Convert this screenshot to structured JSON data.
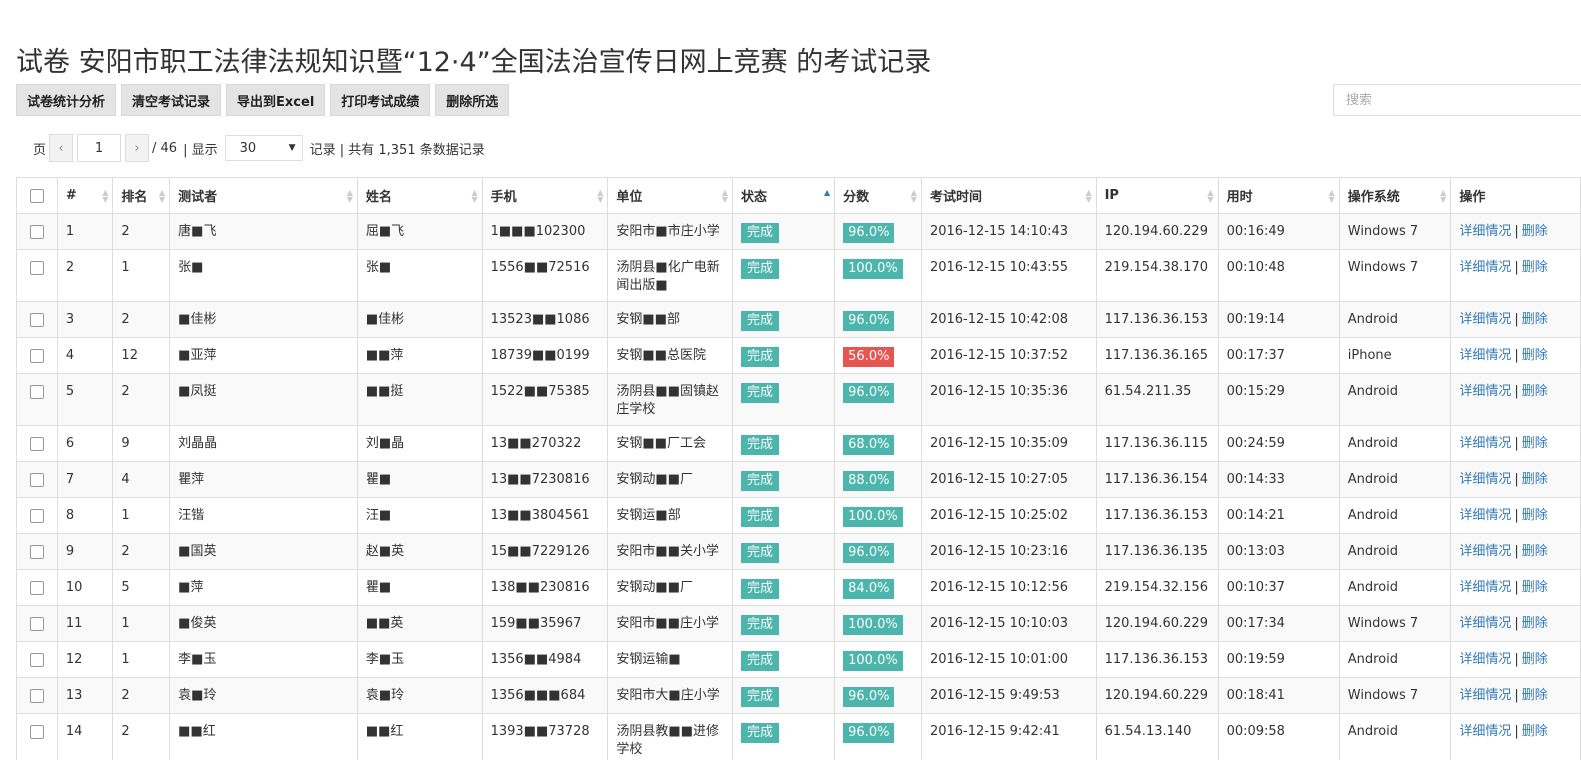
{
  "page": {
    "title": "试卷 安阳市职工法律法规知识暨“12·4”全国法治宣传日网上竞赛 的考试记录"
  },
  "toolbar": {
    "buttons": [
      "试卷统计分析",
      "清空考试记录",
      "导出到Excel",
      "打印考试成绩",
      "删除所选"
    ]
  },
  "search": {
    "placeholder": "搜索"
  },
  "pager": {
    "page_label": "页",
    "prev_icon": "‹",
    "next_icon": "›",
    "current": "1",
    "total_text": "/ 46",
    "display_label": "| 显示",
    "per_page": "30",
    "summary": "记录 | 共有 1,351 条数据记录"
  },
  "table": {
    "headers": [
      "#",
      "排名",
      "测试者",
      "姓名",
      "手机",
      "单位",
      "状态",
      "分数",
      "考试时间",
      "IP",
      "用时",
      "操作系统",
      "操作"
    ],
    "op_detail": "详细情况",
    "op_sep": "|",
    "op_delete": "删除",
    "rows": [
      {
        "idx": "1",
        "rank": "2",
        "tester": "唐■飞",
        "name": "屈■飞",
        "phone": "1■■■102300",
        "unit": "安阳市■市庄小学",
        "status": "完成",
        "score": "96.0%",
        "low": false,
        "time": "2016-12-15 14:10:43",
        "ip": "120.194.60.229",
        "dur": "00:16:49",
        "os": "Windows 7"
      },
      {
        "idx": "2",
        "rank": "1",
        "tester": "张■",
        "name": "张■",
        "phone": "1556■■72516",
        "unit": "汤阴县■化广电新闻出版■",
        "status": "完成",
        "score": "100.0%",
        "low": false,
        "time": "2016-12-15 10:43:55",
        "ip": "219.154.38.170",
        "dur": "00:10:48",
        "os": "Windows 7"
      },
      {
        "idx": "3",
        "rank": "2",
        "tester": "■佳彬",
        "name": "■佳彬",
        "phone": "13523■■1086",
        "unit": "安钢■■部",
        "status": "完成",
        "score": "96.0%",
        "low": false,
        "time": "2016-12-15 10:42:08",
        "ip": "117.136.36.153",
        "dur": "00:19:14",
        "os": "Android"
      },
      {
        "idx": "4",
        "rank": "12",
        "tester": "■亚萍",
        "name": "■■萍",
        "phone": "18739■■0199",
        "unit": "安钢■■总医院",
        "status": "完成",
        "score": "56.0%",
        "low": true,
        "time": "2016-12-15 10:37:52",
        "ip": "117.136.36.165",
        "dur": "00:17:37",
        "os": "iPhone"
      },
      {
        "idx": "5",
        "rank": "2",
        "tester": "■凤挺",
        "name": "■■挺",
        "phone": "1522■■75385",
        "unit": "汤阴县■■固镇赵庄学校",
        "status": "完成",
        "score": "96.0%",
        "low": false,
        "time": "2016-12-15 10:35:36",
        "ip": "61.54.211.35",
        "dur": "00:15:29",
        "os": "Android"
      },
      {
        "idx": "6",
        "rank": "9",
        "tester": "刘晶晶",
        "name": "刘■晶",
        "phone": "13■■270322",
        "unit": "安钢■■厂工会",
        "status": "完成",
        "score": "68.0%",
        "low": false,
        "time": "2016-12-15 10:35:09",
        "ip": "117.136.36.115",
        "dur": "00:24:59",
        "os": "Android"
      },
      {
        "idx": "7",
        "rank": "4",
        "tester": "瞿萍",
        "name": "瞿■",
        "phone": "13■■7230816",
        "unit": "安钢动■■厂",
        "status": "完成",
        "score": "88.0%",
        "low": false,
        "time": "2016-12-15 10:27:05",
        "ip": "117.136.36.154",
        "dur": "00:14:33",
        "os": "Android"
      },
      {
        "idx": "8",
        "rank": "1",
        "tester": "汪锴",
        "name": "汪■",
        "phone": "13■■3804561",
        "unit": "安钢运■部",
        "status": "完成",
        "score": "100.0%",
        "low": false,
        "time": "2016-12-15 10:25:02",
        "ip": "117.136.36.153",
        "dur": "00:14:21",
        "os": "Android"
      },
      {
        "idx": "9",
        "rank": "2",
        "tester": "■国英",
        "name": "赵■英",
        "phone": "15■■7229126",
        "unit": "安阳市■■关小学",
        "status": "完成",
        "score": "96.0%",
        "low": false,
        "time": "2016-12-15 10:23:16",
        "ip": "117.136.36.135",
        "dur": "00:13:03",
        "os": "Android"
      },
      {
        "idx": "10",
        "rank": "5",
        "tester": "■萍",
        "name": "瞿■",
        "phone": "138■■230816",
        "unit": "安钢动■■厂",
        "status": "完成",
        "score": "84.0%",
        "low": false,
        "time": "2016-12-15 10:12:56",
        "ip": "219.154.32.156",
        "dur": "00:10:37",
        "os": "Android"
      },
      {
        "idx": "11",
        "rank": "1",
        "tester": "■俊英",
        "name": "■■英",
        "phone": "159■■35967",
        "unit": "安阳市■■庄小学",
        "status": "完成",
        "score": "100.0%",
        "low": false,
        "time": "2016-12-15 10:10:03",
        "ip": "120.194.60.229",
        "dur": "00:17:34",
        "os": "Windows 7"
      },
      {
        "idx": "12",
        "rank": "1",
        "tester": "李■玉",
        "name": "李■玉",
        "phone": "1356■■4984",
        "unit": "安钢运输■",
        "status": "完成",
        "score": "100.0%",
        "low": false,
        "time": "2016-12-15 10:01:00",
        "ip": "117.136.36.153",
        "dur": "00:19:59",
        "os": "Android"
      },
      {
        "idx": "13",
        "rank": "2",
        "tester": "袁■玲",
        "name": "袁■玲",
        "phone": "1356■■■684",
        "unit": "安阳市大■庄小学",
        "status": "完成",
        "score": "96.0%",
        "low": false,
        "time": "2016-12-15 9:49:53",
        "ip": "120.194.60.229",
        "dur": "00:18:41",
        "os": "Windows 7"
      },
      {
        "idx": "14",
        "rank": "2",
        "tester": "■■红",
        "name": "■■红",
        "phone": "1393■■73728",
        "unit": "汤阴县教■■进修学校",
        "status": "完成",
        "score": "96.0%",
        "low": false,
        "time": "2016-12-15 9:42:41",
        "ip": "61.54.13.140",
        "dur": "00:09:58",
        "os": "Android"
      }
    ]
  }
}
